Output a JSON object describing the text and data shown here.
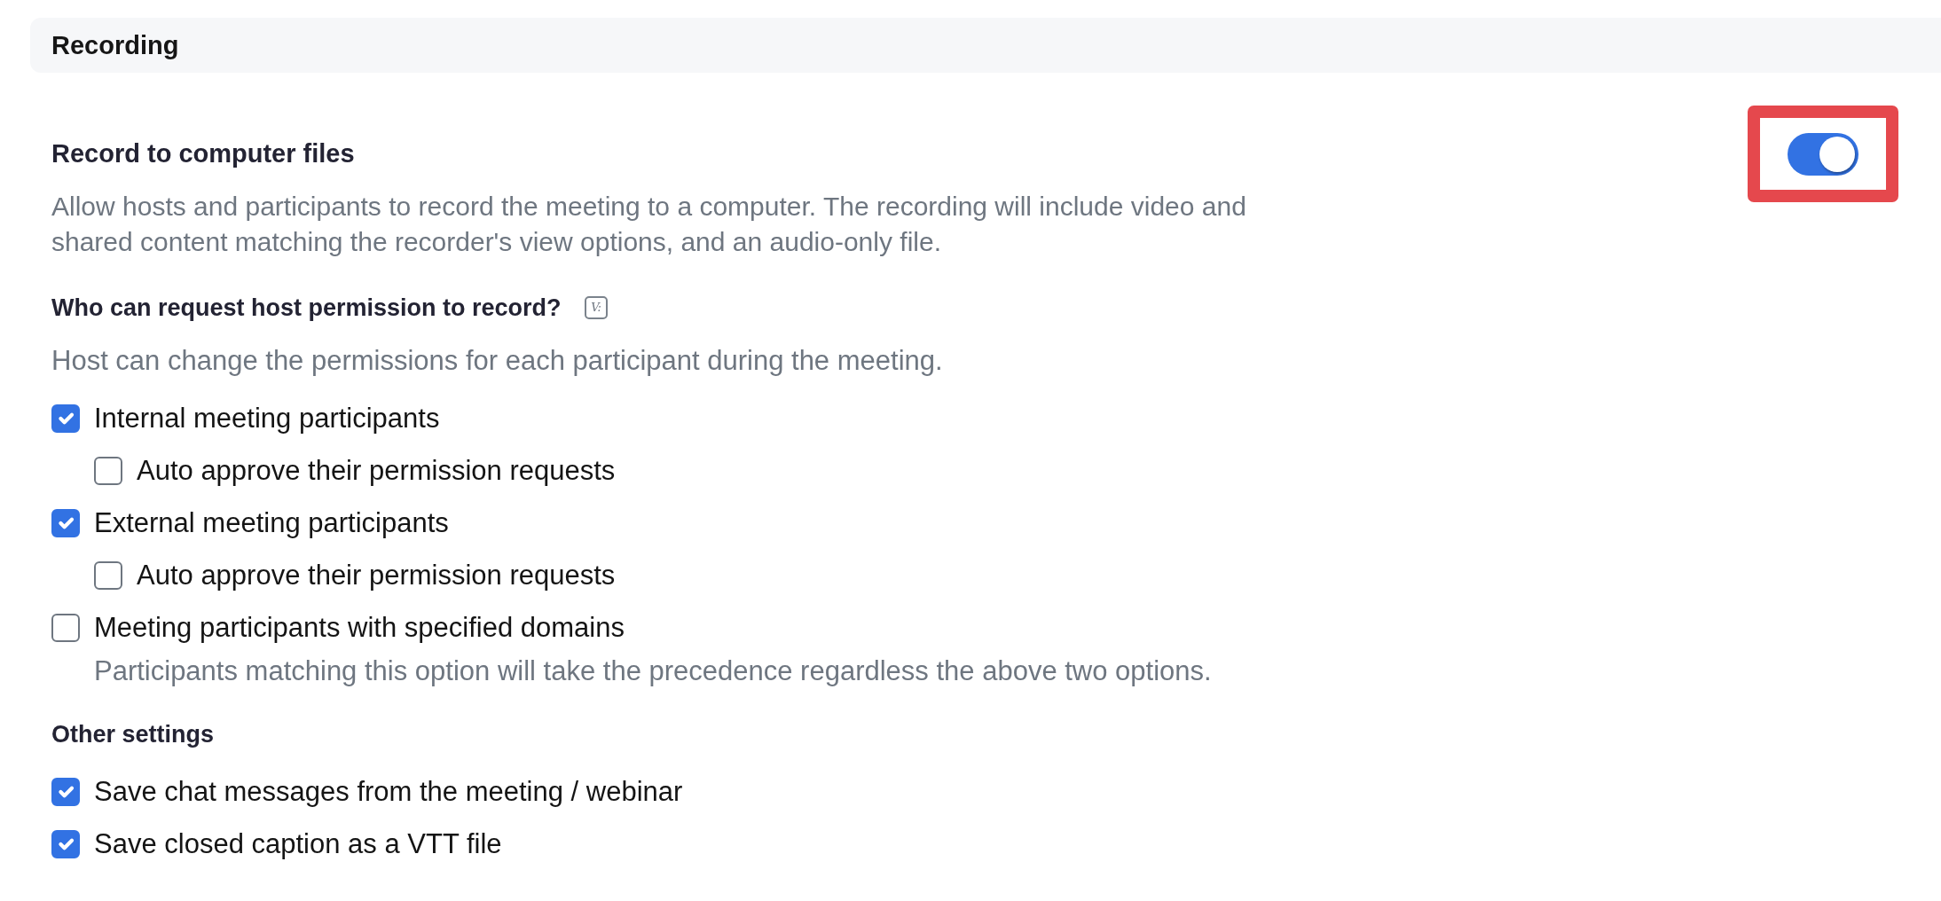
{
  "section": {
    "title": "Recording"
  },
  "setting": {
    "title": "Record to computer files",
    "description": "Allow hosts and participants to record the meeting to a computer. The recording will include video and shared content matching the recorder's view options, and an audio-only file.",
    "toggle": {
      "on": true,
      "highlighted": true
    }
  },
  "permission": {
    "title": "Who can request host permission to record?",
    "badge": "V:",
    "hint": "Host can change the permissions for each participant during the meeting.",
    "options": [
      {
        "label": "Internal meeting participants",
        "checked": true,
        "children": [
          {
            "label": "Auto approve their permission requests",
            "checked": false
          }
        ]
      },
      {
        "label": "External meeting participants",
        "checked": true,
        "children": [
          {
            "label": "Auto approve their permission requests",
            "checked": false
          }
        ]
      },
      {
        "label": "Meeting participants with specified domains",
        "checked": false,
        "note": "Participants matching this option will take the precedence regardless the above two options."
      }
    ]
  },
  "other_settings": {
    "title": "Other settings",
    "options": [
      {
        "label": "Save chat messages from the meeting / webinar",
        "checked": true
      },
      {
        "label": "Save closed caption as a VTT file",
        "checked": true
      }
    ]
  }
}
